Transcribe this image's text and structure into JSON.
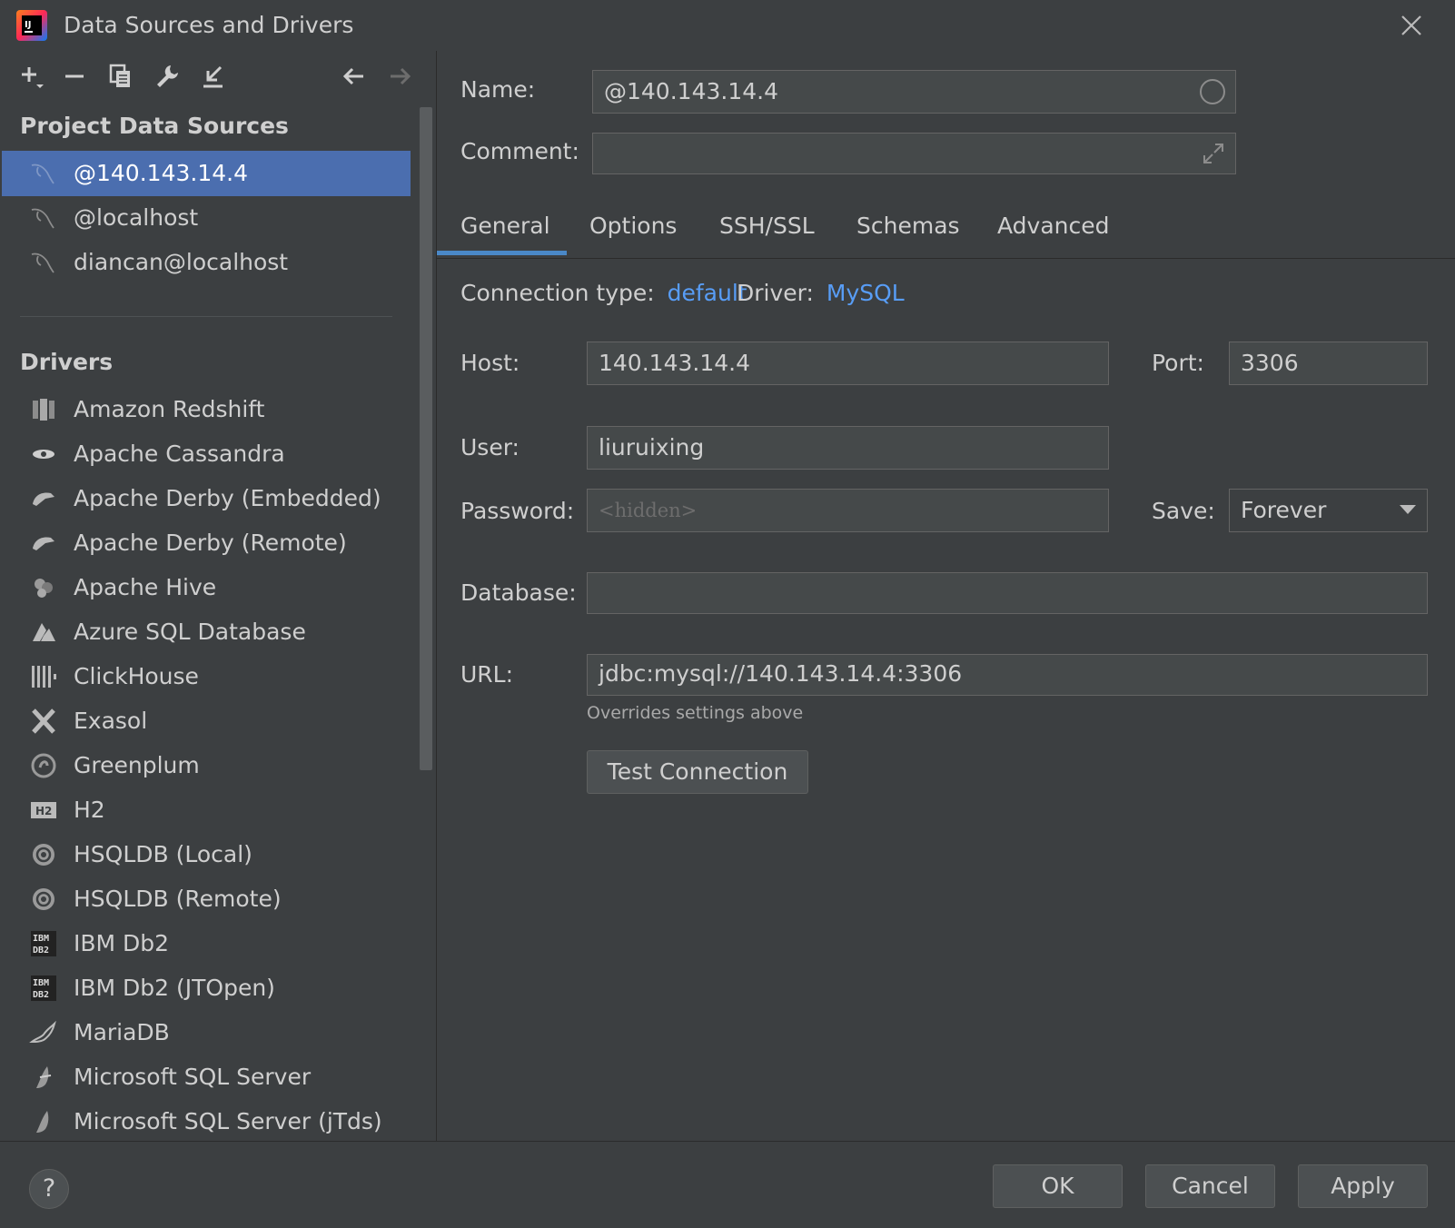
{
  "window": {
    "title": "Data Sources and Drivers"
  },
  "toolbar": {
    "buttons": [
      "add-icon",
      "remove-icon",
      "duplicate-icon",
      "wrench-icon",
      "import-icon",
      "back-arrow-icon",
      "forward-arrow-icon"
    ]
  },
  "sidebar": {
    "project_header": "Project Data Sources",
    "data_sources": [
      {
        "label": "@140.143.14.4",
        "selected": true
      },
      {
        "label": "@localhost",
        "selected": false
      },
      {
        "label": "diancan@localhost",
        "selected": false
      }
    ],
    "drivers_header": "Drivers",
    "drivers": [
      {
        "label": "Amazon Redshift",
        "icon": "redshift-icon"
      },
      {
        "label": "Apache Cassandra",
        "icon": "cassandra-icon"
      },
      {
        "label": "Apache Derby (Embedded)",
        "icon": "derby-icon"
      },
      {
        "label": "Apache Derby (Remote)",
        "icon": "derby-icon"
      },
      {
        "label": "Apache Hive",
        "icon": "hive-icon"
      },
      {
        "label": "Azure SQL Database",
        "icon": "azure-icon"
      },
      {
        "label": "ClickHouse",
        "icon": "clickhouse-icon"
      },
      {
        "label": "Exasol",
        "icon": "exasol-icon"
      },
      {
        "label": "Greenplum",
        "icon": "greenplum-icon"
      },
      {
        "label": "H2",
        "icon": "h2-icon"
      },
      {
        "label": "HSQLDB (Local)",
        "icon": "hsqldb-icon"
      },
      {
        "label": "HSQLDB (Remote)",
        "icon": "hsqldb-icon"
      },
      {
        "label": "IBM Db2",
        "icon": "db2-icon"
      },
      {
        "label": "IBM Db2 (JTOpen)",
        "icon": "db2-icon"
      },
      {
        "label": "MariaDB",
        "icon": "mariadb-icon"
      },
      {
        "label": "Microsoft SQL Server",
        "icon": "sqlserver-icon"
      }
    ],
    "partial_item": "Microsoft SQL Server (jTds)"
  },
  "form": {
    "name_label": "Name:",
    "name_value": "@140.143.14.4",
    "comment_label": "Comment:",
    "comment_value": "",
    "tabs": [
      "General",
      "Options",
      "SSH/SSL",
      "Schemas",
      "Advanced"
    ],
    "active_tab": "General",
    "connection_type_label": "Connection type:",
    "connection_type_value": "default",
    "driver_label": "Driver:",
    "driver_value": "MySQL",
    "host_label": "Host:",
    "host_value": "140.143.14.4",
    "port_label": "Port:",
    "port_value": "3306",
    "user_label": "User:",
    "user_value": "liuruixing",
    "password_label": "Password:",
    "password_placeholder": "<hidden>",
    "save_label": "Save:",
    "save_value": "Forever",
    "database_label": "Database:",
    "database_value": "",
    "url_label": "URL:",
    "url_value": "jdbc:mysql://140.143.14.4:3306",
    "url_hint": "Overrides settings above",
    "test_connection": "Test Connection"
  },
  "footer": {
    "help": "?",
    "ok": "OK",
    "cancel": "Cancel",
    "apply": "Apply"
  },
  "colors": {
    "background": "#3c3f41",
    "selection": "#4b6eaf",
    "link": "#589df6",
    "tab_underline": "#4a88c7"
  }
}
